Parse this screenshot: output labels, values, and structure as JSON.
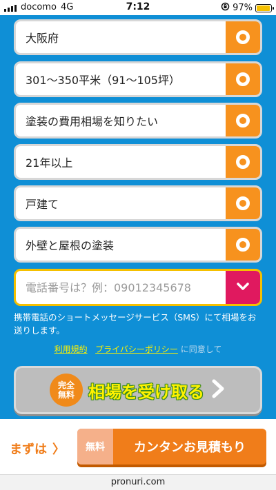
{
  "status_bar": {
    "carrier": "docomo",
    "network": "4G",
    "time": "7:12",
    "battery_percent": "97%",
    "battery_level": 0.97
  },
  "form": {
    "options": [
      {
        "label": "大阪府"
      },
      {
        "label": "301〜350平米（91〜105坪）"
      },
      {
        "label": "塗装の費用相場を知りたい"
      },
      {
        "label": "21年以上"
      },
      {
        "label": "戸建て"
      },
      {
        "label": "外壁と屋根の塗装"
      }
    ],
    "phone": {
      "placeholder": "電話番号は？例：09012345678",
      "value": ""
    },
    "sms_note": "携帯電話のショートメッセージサービス（SMS）にて相場をお送りします。",
    "agreement": {
      "terms_link": "利用規約",
      "privacy_link": "プライバシーポリシー",
      "suffix": "に同意して"
    },
    "cta": {
      "badge_line1": "完全",
      "badge_line2": "無料",
      "label": "相場を受け取る"
    }
  },
  "bottom_bar": {
    "prefix": "まずは",
    "prefix_chevron": "〉",
    "tag": "無料",
    "label": "カンタンお見積もり"
  },
  "url": "pronuri.com",
  "colors": {
    "page_blue": "#0f8fd6",
    "check_orange": "#f7921e",
    "dropdown_pink": "#e0195f",
    "highlight_yellow": "#f5c000",
    "cta_gray": "#bdbdbd",
    "estimate_orange": "#f07d1a"
  }
}
